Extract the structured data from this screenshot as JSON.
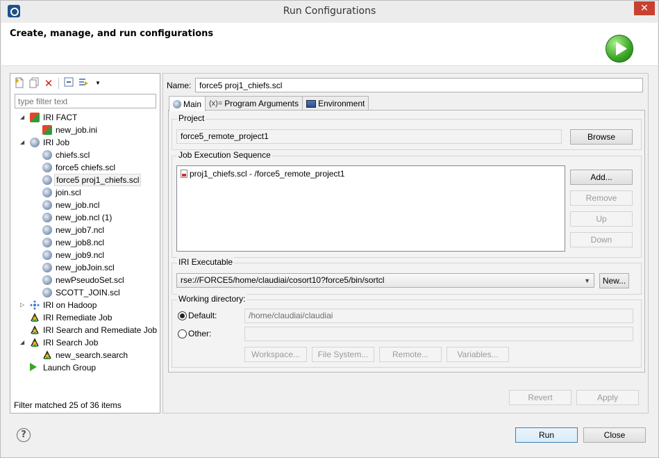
{
  "window": {
    "title": "Run Configurations",
    "close_glyph": "✕"
  },
  "banner": {
    "title": "Create, manage, and run configurations",
    "icon": "run-icon"
  },
  "left": {
    "filter_placeholder": "type filter text",
    "tree": [
      {
        "label": "IRI FACT",
        "level": 0,
        "expanded": true,
        "icon": "fact-icon"
      },
      {
        "label": "new_job.ini",
        "level": 1,
        "icon": "fact-icon"
      },
      {
        "label": "IRI Job",
        "level": 0,
        "expanded": true,
        "icon": "job-icon"
      },
      {
        "label": "chiefs.scl",
        "level": 1,
        "icon": "job-icon"
      },
      {
        "label": "force5 chiefs.scl",
        "level": 1,
        "icon": "job-icon"
      },
      {
        "label": "force5 proj1_chiefs.scl",
        "level": 1,
        "icon": "job-icon",
        "selected": true
      },
      {
        "label": "join.scl",
        "level": 1,
        "icon": "job-icon"
      },
      {
        "label": "new_job.ncl",
        "level": 1,
        "icon": "job-icon"
      },
      {
        "label": "new_job.ncl (1)",
        "level": 1,
        "icon": "job-icon"
      },
      {
        "label": "new_job7.ncl",
        "level": 1,
        "icon": "job-icon"
      },
      {
        "label": "new_job8.ncl",
        "level": 1,
        "icon": "job-icon"
      },
      {
        "label": "new_job9.ncl",
        "level": 1,
        "icon": "job-icon"
      },
      {
        "label": "new_jobJoin.scl",
        "level": 1,
        "icon": "job-icon"
      },
      {
        "label": "newPseudoSet.scl",
        "level": 1,
        "icon": "job-icon"
      },
      {
        "label": "SCOTT_JOIN.scl",
        "level": 1,
        "icon": "job-icon"
      },
      {
        "label": "IRI on Hadoop",
        "level": 0,
        "expanded": false,
        "icon": "hadoop-icon"
      },
      {
        "label": "IRI Remediate Job",
        "level": 0,
        "icon": "remediate-icon"
      },
      {
        "label": "IRI Search and Remediate Job",
        "level": 0,
        "icon": "remediate-icon"
      },
      {
        "label": "IRI Search Job",
        "level": 0,
        "expanded": true,
        "icon": "remediate-icon"
      },
      {
        "label": "new_search.search",
        "level": 1,
        "icon": "remediate-icon"
      },
      {
        "label": "Launch Group",
        "level": 0,
        "icon": "launch-icon"
      }
    ],
    "status": "Filter matched 25 of 36 items"
  },
  "right": {
    "name_label": "Name:",
    "name_value": "force5 proj1_chiefs.scl",
    "tabs": [
      {
        "label": "Main",
        "active": true
      },
      {
        "label": "Program Arguments",
        "prefix": "(x)="
      },
      {
        "label": "Environment"
      }
    ],
    "project": {
      "label": "Project",
      "value": "force5_remote_project1",
      "browse": "Browse"
    },
    "sequence": {
      "label": "Job Execution Sequence",
      "items": [
        "proj1_chiefs.scl - /force5_remote_project1"
      ],
      "add": "Add...",
      "remove": "Remove",
      "up": "Up",
      "down": "Down"
    },
    "executable": {
      "label": "IRI Executable",
      "value": "rse://FORCE5/home/claudiai/cosort10?force5/bin/sortcl",
      "new": "New..."
    },
    "workdir": {
      "label": "Working directory:",
      "default_label": "Default:",
      "default_value": "/home/claudiai/claudiai",
      "other_label": "Other:",
      "other_value": "",
      "workspace": "Workspace...",
      "filesystem": "File System...",
      "remote": "Remote...",
      "variables": "Variables..."
    },
    "revert": "Revert",
    "apply": "Apply"
  },
  "footer": {
    "run": "Run",
    "close": "Close",
    "help": "?"
  }
}
